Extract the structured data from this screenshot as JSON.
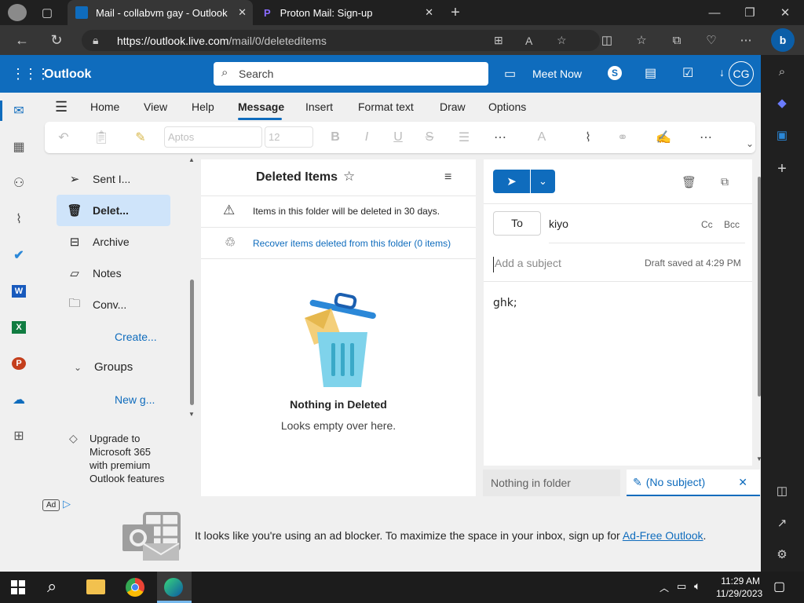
{
  "browser": {
    "tabs": [
      {
        "title": "Mail - collabvm gay - Outlook"
      },
      {
        "title": "Proton Mail: Sign-up"
      }
    ],
    "url_host": "https://outlook.live.com",
    "url_path": "/mail/0/deleteditems"
  },
  "outlook": {
    "app_name": "Outlook",
    "search_placeholder": "Search",
    "meet_now": "Meet Now",
    "avatar_initials": "CG",
    "ribbon_tabs": [
      "Home",
      "View",
      "Help",
      "Message",
      "Insert",
      "Format text",
      "Draw",
      "Options"
    ],
    "font_name": "Aptos",
    "font_size": "12"
  },
  "folders": {
    "items": [
      {
        "label": "Sent I..."
      },
      {
        "label": "Delet..."
      },
      {
        "label": "Archive"
      },
      {
        "label": "Notes"
      },
      {
        "label": "Conv..."
      }
    ],
    "create": "Create...",
    "groups": "Groups",
    "new_group": "New g...",
    "upgrade": "Upgrade to Microsoft 365 with premium Outlook features",
    "ad_badge": "Ad"
  },
  "msglist": {
    "title": "Deleted Items",
    "notice": "Items in this folder will be deleted in 30 days.",
    "recover": "Recover items deleted from this folder (0 items)",
    "empty_title": "Nothing in Deleted",
    "empty_sub": "Looks empty over here."
  },
  "compose": {
    "to_label": "To",
    "recipient": "kiyo",
    "cc": "Cc",
    "bcc": "Bcc",
    "subject_placeholder": "Add a subject",
    "draft_saved": "Draft saved at 4:29 PM",
    "body": "ghk;"
  },
  "bottom_tabs": {
    "nothing": "Nothing in folder",
    "no_subject": "(No subject)"
  },
  "ad": {
    "text": "It looks like you're using an ad blocker. To maximize the space in your inbox, sign up for ",
    "link": "Ad-Free Outlook",
    "end": "."
  },
  "taskbar": {
    "time": "11:29 AM",
    "date": "11/29/2023"
  },
  "colors": {
    "brand": "#0f6cbd",
    "selected": "#cfe4fa"
  }
}
